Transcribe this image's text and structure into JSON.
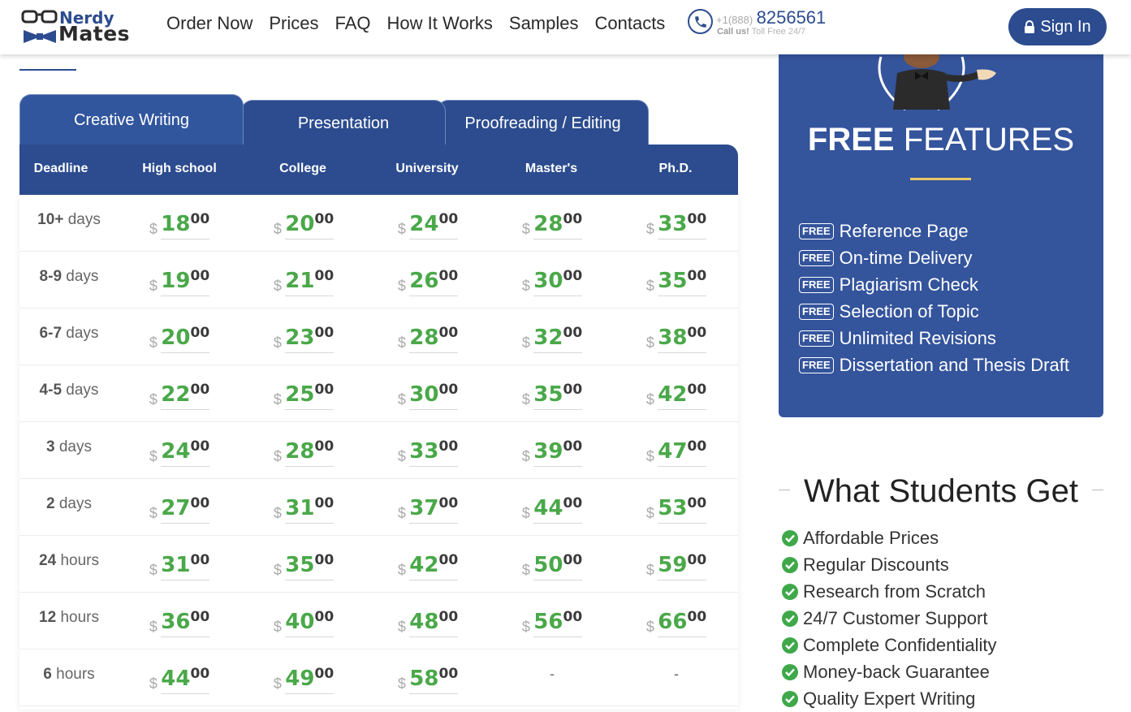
{
  "header": {
    "logo_top": "Nerdy",
    "logo_bottom": "Mates",
    "nav": [
      "Order Now",
      "Prices",
      "FAQ",
      "How It Works",
      "Samples",
      "Contacts"
    ],
    "phone_prefix": "+1(888)",
    "phone_number": "8256561",
    "phone_sub_bold": "Call us!",
    "phone_sub": " Toll Free 24/7",
    "signin": "Sign In"
  },
  "tabs": [
    "Creative Writing",
    "Presentation",
    "Proofreading / Editing"
  ],
  "table": {
    "headers": [
      "Deadline",
      "High school",
      "College",
      "University",
      "Master's",
      "Ph.D."
    ],
    "currency": "$",
    "rows": [
      {
        "num": "10+",
        "unit": "days",
        "prices": [
          [
            "18",
            "00"
          ],
          [
            "20",
            "00"
          ],
          [
            "24",
            "00"
          ],
          [
            "28",
            "00"
          ],
          [
            "33",
            "00"
          ]
        ]
      },
      {
        "num": "8-9",
        "unit": "days",
        "prices": [
          [
            "19",
            "00"
          ],
          [
            "21",
            "00"
          ],
          [
            "26",
            "00"
          ],
          [
            "30",
            "00"
          ],
          [
            "35",
            "00"
          ]
        ]
      },
      {
        "num": "6-7",
        "unit": "days",
        "prices": [
          [
            "20",
            "00"
          ],
          [
            "23",
            "00"
          ],
          [
            "28",
            "00"
          ],
          [
            "32",
            "00"
          ],
          [
            "38",
            "00"
          ]
        ]
      },
      {
        "num": "4-5",
        "unit": "days",
        "prices": [
          [
            "22",
            "00"
          ],
          [
            "25",
            "00"
          ],
          [
            "30",
            "00"
          ],
          [
            "35",
            "00"
          ],
          [
            "42",
            "00"
          ]
        ]
      },
      {
        "num": "3",
        "unit": "days",
        "prices": [
          [
            "24",
            "00"
          ],
          [
            "28",
            "00"
          ],
          [
            "33",
            "00"
          ],
          [
            "39",
            "00"
          ],
          [
            "47",
            "00"
          ]
        ]
      },
      {
        "num": "2",
        "unit": "days",
        "prices": [
          [
            "27",
            "00"
          ],
          [
            "31",
            "00"
          ],
          [
            "37",
            "00"
          ],
          [
            "44",
            "00"
          ],
          [
            "53",
            "00"
          ]
        ]
      },
      {
        "num": "24",
        "unit": "hours",
        "prices": [
          [
            "31",
            "00"
          ],
          [
            "35",
            "00"
          ],
          [
            "42",
            "00"
          ],
          [
            "50",
            "00"
          ],
          [
            "59",
            "00"
          ]
        ]
      },
      {
        "num": "12",
        "unit": "hours",
        "prices": [
          [
            "36",
            "00"
          ],
          [
            "40",
            "00"
          ],
          [
            "48",
            "00"
          ],
          [
            "56",
            "00"
          ],
          [
            "66",
            "00"
          ]
        ]
      },
      {
        "num": "6",
        "unit": "hours",
        "prices": [
          [
            "44",
            "00"
          ],
          [
            "49",
            "00"
          ],
          [
            "58",
            "00"
          ],
          null,
          null
        ]
      }
    ],
    "empty": "-"
  },
  "free_features": {
    "title_bold": "FREE",
    "title_rest": " FEATURES",
    "badge": "FREE",
    "items": [
      "Reference Page",
      "On-time Delivery",
      "Plagiarism Check",
      "Selection of Topic",
      "Unlimited Revisions",
      "Dissertation and Thesis Draft"
    ]
  },
  "what_students_get": {
    "title": "What Students Get",
    "items": [
      "Affordable Prices",
      "Regular Discounts",
      "Research from Scratch",
      "24/7 Customer Support",
      "Complete Confidentiality",
      "Money-back Guarantee",
      "Quality Expert Writing"
    ]
  },
  "colors": {
    "brand": "#2c4c8f",
    "price_green": "#4aa849",
    "check_green": "#3fa84a",
    "accent_gold": "#e8c766"
  }
}
